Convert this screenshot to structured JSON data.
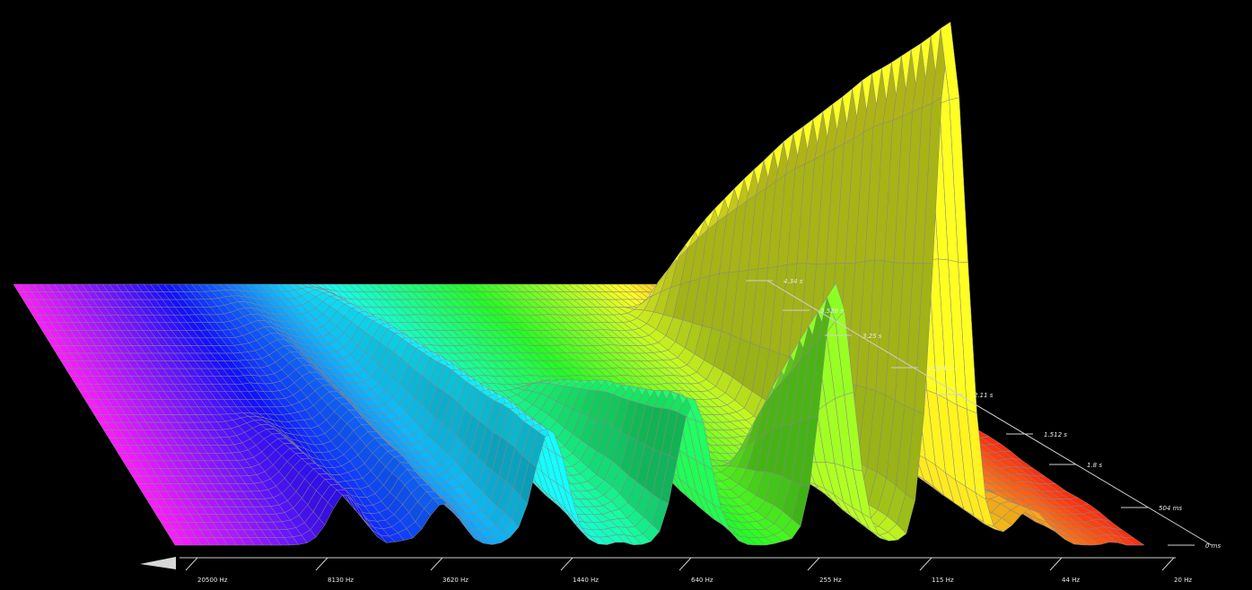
{
  "chart_data": {
    "type": "waterfall-3d",
    "title": "",
    "frequency_axis": {
      "scale": "log",
      "direction": "high-to-low (left to right)",
      "ticks": [
        "20500 Hz",
        "8130 Hz",
        "3620 Hz",
        "1440 Hz",
        "640 Hz",
        "255 Hz",
        "115 Hz",
        "44 Hz",
        "20 Hz"
      ],
      "range_hz": [
        20500,
        20
      ]
    },
    "time_axis": {
      "ticks": [
        "0 ms",
        "504 ms",
        "1.8 s",
        "1.512 s",
        "2.11 s",
        "2.521 s",
        "3.25 s",
        "3.539 s",
        "4.34 s"
      ],
      "range_s": [
        0,
        4.34
      ]
    },
    "colormap": {
      "stops": [
        "#ff1cff",
        "#1010ff",
        "#10ffff",
        "#20ff20",
        "#ffff20",
        "#ff2a10"
      ],
      "mapped_to": "frequency"
    },
    "mesh_color": "#888888",
    "series": [
      {
        "freq_hz": 80,
        "peak_level": 1.0,
        "decay_s": 3.9
      },
      {
        "freq_hz": 180,
        "peak_level": 0.5,
        "decay_s": 1.3
      },
      {
        "freq_hz": 500,
        "peak_level": 0.28,
        "decay_s": 2.6
      },
      {
        "freq_hz": 1400,
        "peak_level": 0.22,
        "decay_s": 4.3
      },
      {
        "freq_hz": 3000,
        "peak_level": 0.08,
        "decay_s": 4.3
      },
      {
        "freq_hz": 6000,
        "peak_level": 0.1,
        "decay_s": 2.2
      },
      {
        "freq_hz": 45,
        "peak_level": 0.07,
        "decay_s": 1.0
      }
    ],
    "grid": true
  }
}
